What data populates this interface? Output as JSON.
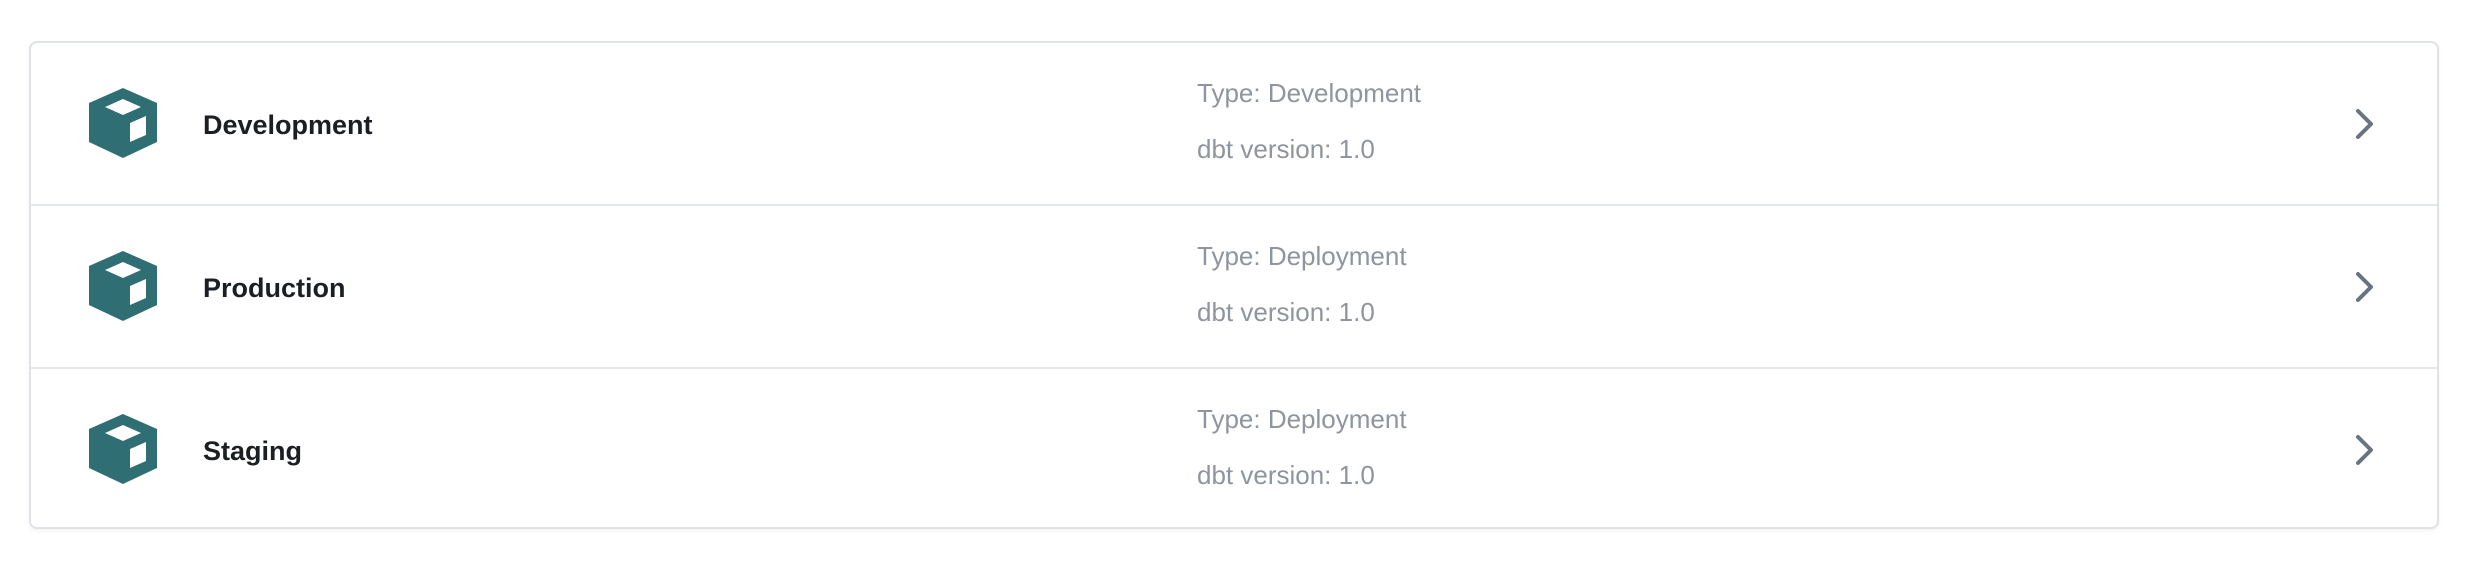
{
  "colors": {
    "icon": "#2f6f73",
    "name_text": "#1b1f24",
    "meta_text": "#8e959e",
    "chevron": "#6b7280",
    "border": "#dfe3e8"
  },
  "environments": [
    {
      "icon": "cube-icon",
      "name": "Development",
      "type_text": "Type: Development",
      "version_text": "dbt version: 1.0",
      "chevron_icon": "chevron-right-icon"
    },
    {
      "icon": "cube-icon",
      "name": "Production",
      "type_text": "Type: Deployment",
      "version_text": "dbt version: 1.0",
      "chevron_icon": "chevron-right-icon"
    },
    {
      "icon": "cube-icon",
      "name": "Staging",
      "type_text": "Type: Deployment",
      "version_text": "dbt version: 1.0",
      "chevron_icon": "chevron-right-icon"
    }
  ]
}
